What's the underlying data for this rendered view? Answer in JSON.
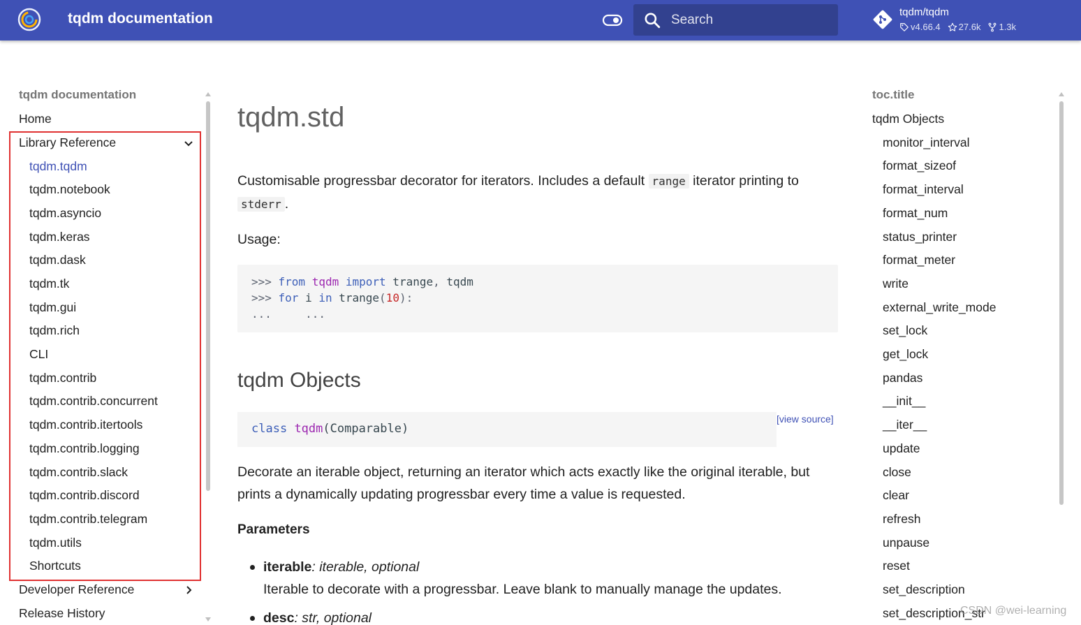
{
  "header": {
    "title": "tqdm documentation",
    "search_placeholder": "Search",
    "repo": {
      "name": "tqdm/tqdm",
      "version": "v4.66.4",
      "stars": "27.6k",
      "forks": "1.3k"
    }
  },
  "nav": {
    "title": "tqdm documentation",
    "items": [
      {
        "label": "Home"
      },
      {
        "label": "Library Reference",
        "expanded": true
      },
      {
        "label": "tqdm.tqdm",
        "active": true
      },
      {
        "label": "tqdm.notebook"
      },
      {
        "label": "tqdm.asyncio"
      },
      {
        "label": "tqdm.keras"
      },
      {
        "label": "tqdm.dask"
      },
      {
        "label": "tqdm.tk"
      },
      {
        "label": "tqdm.gui"
      },
      {
        "label": "tqdm.rich"
      },
      {
        "label": "CLI"
      },
      {
        "label": "tqdm.contrib"
      },
      {
        "label": "tqdm.contrib.concurrent"
      },
      {
        "label": "tqdm.contrib.itertools"
      },
      {
        "label": "tqdm.contrib.logging"
      },
      {
        "label": "tqdm.contrib.slack"
      },
      {
        "label": "tqdm.contrib.discord"
      },
      {
        "label": "tqdm.contrib.telegram"
      },
      {
        "label": "tqdm.utils"
      },
      {
        "label": "Shortcuts"
      },
      {
        "label": "Developer Reference",
        "expanded": false
      },
      {
        "label": "Release History"
      }
    ]
  },
  "main": {
    "title": "tqdm.std",
    "intro": {
      "before": "Customisable progressbar decorator for iterators. Includes a default",
      "code1": "range",
      "middle": "iterator printing to",
      "code2": "stderr",
      "after": "."
    },
    "usage_label": "Usage:",
    "code_lines": [
      [
        {
          "t": "prompt",
          "v": ">>> "
        },
        {
          "t": "kw",
          "v": "from"
        },
        {
          "t": "plain",
          "v": " "
        },
        {
          "t": "mod",
          "v": "tqdm"
        },
        {
          "t": "plain",
          "v": " "
        },
        {
          "t": "kw",
          "v": "import"
        },
        {
          "t": "plain",
          "v": " trange"
        },
        {
          "t": "prompt",
          "v": ","
        },
        {
          "t": "plain",
          "v": " tqdm"
        }
      ],
      [
        {
          "t": "prompt",
          "v": ">>> "
        },
        {
          "t": "kw",
          "v": "for"
        },
        {
          "t": "plain",
          "v": " i "
        },
        {
          "t": "kw",
          "v": "in"
        },
        {
          "t": "plain",
          "v": " trange"
        },
        {
          "t": "prompt",
          "v": "("
        },
        {
          "t": "num",
          "v": "10"
        },
        {
          "t": "prompt",
          "v": "):"
        }
      ],
      [
        {
          "t": "prompt",
          "v": "...     ..."
        }
      ]
    ],
    "section_title": "tqdm Objects",
    "class_sig": {
      "kw": "class",
      "name": "tqdm",
      "args": "(Comparable)"
    },
    "view_source": "[view source]",
    "description": "Decorate an iterable object, returning an iterator which acts exactly like the original iterable, but prints a dynamically updating progressbar every time a value is requested.",
    "params_title": "Parameters",
    "params": [
      {
        "name": "iterable",
        "type": ": iterable, optional",
        "desc": "Iterable to decorate with a progressbar. Leave blank to manually manage the updates."
      },
      {
        "name": "desc",
        "type": ": str, optional",
        "desc": ""
      }
    ]
  },
  "toc": {
    "title": "toc.title",
    "items": [
      {
        "label": "tqdm Objects",
        "level": 0
      },
      {
        "label": "monitor_interval",
        "level": 1
      },
      {
        "label": "format_sizeof",
        "level": 1
      },
      {
        "label": "format_interval",
        "level": 1
      },
      {
        "label": "format_num",
        "level": 1
      },
      {
        "label": "status_printer",
        "level": 1
      },
      {
        "label": "format_meter",
        "level": 1
      },
      {
        "label": "write",
        "level": 1
      },
      {
        "label": "external_write_mode",
        "level": 1
      },
      {
        "label": "set_lock",
        "level": 1
      },
      {
        "label": "get_lock",
        "level": 1
      },
      {
        "label": "pandas",
        "level": 1
      },
      {
        "label": "__init__",
        "level": 1
      },
      {
        "label": "__iter__",
        "level": 1
      },
      {
        "label": "update",
        "level": 1
      },
      {
        "label": "close",
        "level": 1
      },
      {
        "label": "clear",
        "level": 1
      },
      {
        "label": "refresh",
        "level": 1
      },
      {
        "label": "unpause",
        "level": 1
      },
      {
        "label": "reset",
        "level": 1
      },
      {
        "label": "set_description",
        "level": 1
      },
      {
        "label": "set_description_str",
        "level": 1
      }
    ]
  },
  "watermark": "CSDN @wei-learning",
  "colors": {
    "header": "#3f51b5",
    "accent": "#3f51b5",
    "highlight_box": "#e03131"
  }
}
